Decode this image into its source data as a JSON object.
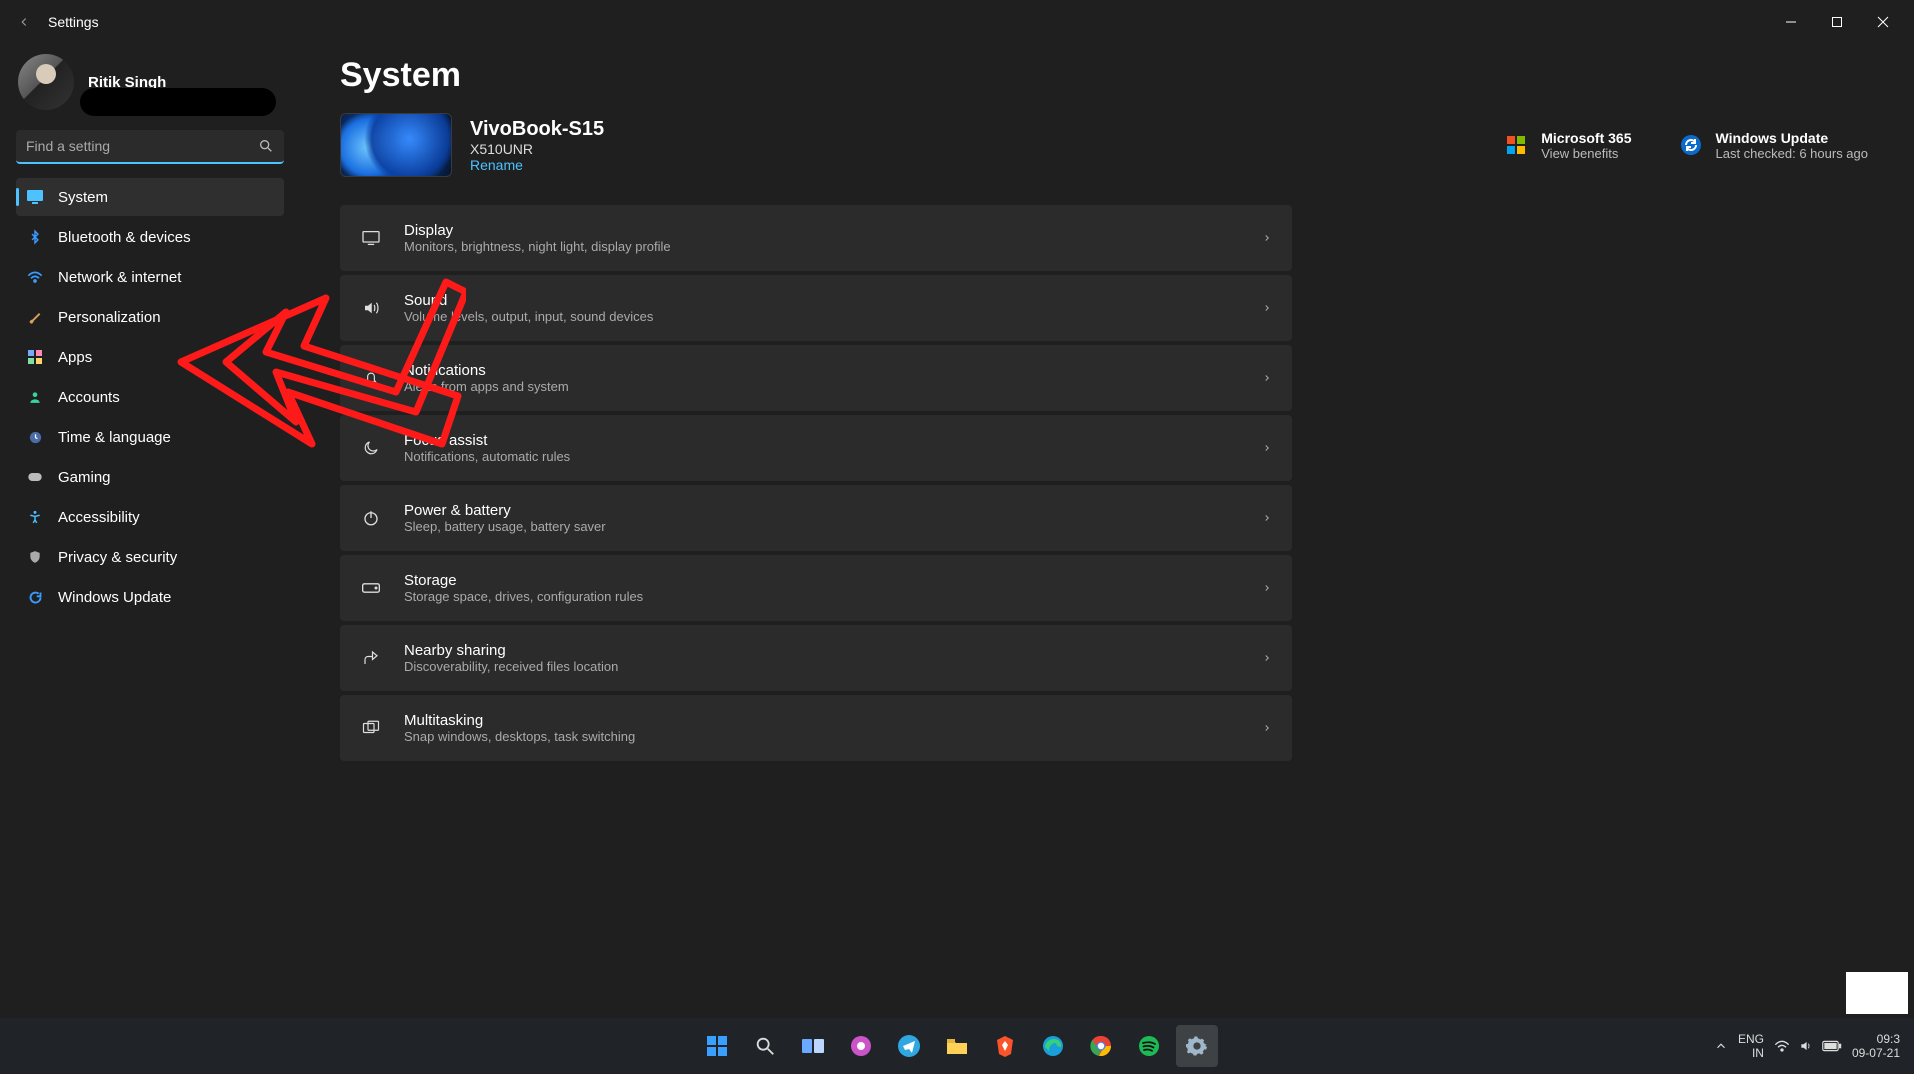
{
  "window": {
    "title": "Settings"
  },
  "user": {
    "name": "Ritik Singh"
  },
  "search": {
    "placeholder": "Find a setting"
  },
  "sidebar": {
    "items": [
      {
        "label": "System"
      },
      {
        "label": "Bluetooth & devices"
      },
      {
        "label": "Network & internet"
      },
      {
        "label": "Personalization"
      },
      {
        "label": "Apps"
      },
      {
        "label": "Accounts"
      },
      {
        "label": "Time & language"
      },
      {
        "label": "Gaming"
      },
      {
        "label": "Accessibility"
      },
      {
        "label": "Privacy & security"
      },
      {
        "label": "Windows Update"
      }
    ]
  },
  "page": {
    "title": "System",
    "device": {
      "name": "VivoBook-S15",
      "model": "X510UNR",
      "rename": "Rename"
    },
    "quick": [
      {
        "title": "Microsoft 365",
        "sub": "View benefits"
      },
      {
        "title": "Windows Update",
        "sub": "Last checked: 6 hours ago"
      }
    ],
    "cards": [
      {
        "title": "Display",
        "sub": "Monitors, brightness, night light, display profile"
      },
      {
        "title": "Sound",
        "sub": "Volume levels, output, input, sound devices"
      },
      {
        "title": "Notifications",
        "sub": "Alerts from apps and system"
      },
      {
        "title": "Focus assist",
        "sub": "Notifications, automatic rules"
      },
      {
        "title": "Power & battery",
        "sub": "Sleep, battery usage, battery saver"
      },
      {
        "title": "Storage",
        "sub": "Storage space, drives, configuration rules"
      },
      {
        "title": "Nearby sharing",
        "sub": "Discoverability, received files location"
      },
      {
        "title": "Multitasking",
        "sub": "Snap windows, desktops, task switching"
      }
    ]
  },
  "taskbar": {
    "lang1": "ENG",
    "lang2": "IN",
    "time": "09:3",
    "date": "09-07-21"
  }
}
